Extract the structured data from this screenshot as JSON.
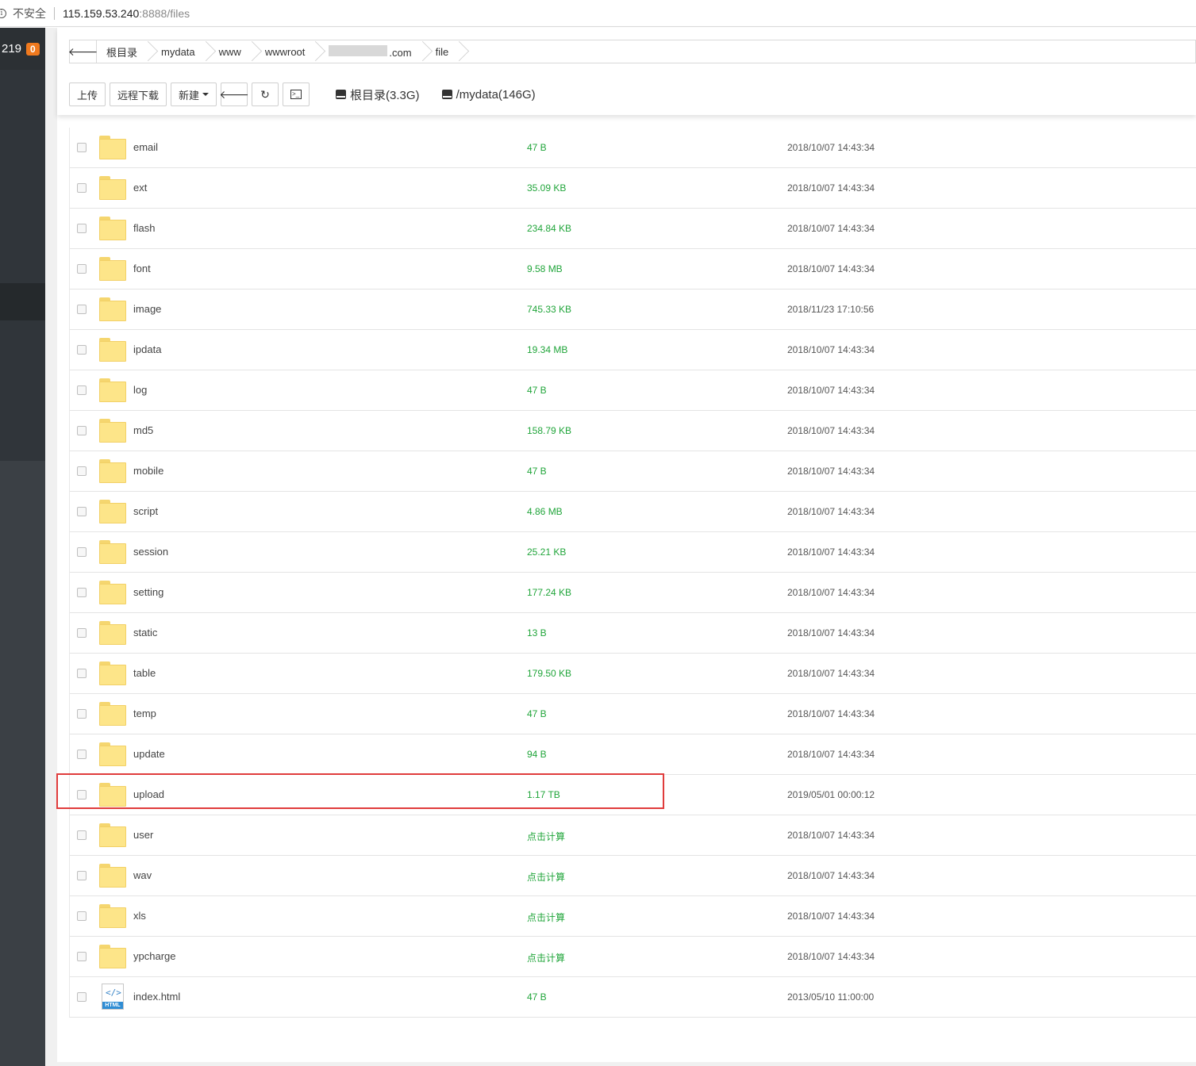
{
  "browser": {
    "insecure_label": "不安全",
    "url_host": "115.159.53.240",
    "url_path": ":8888/files"
  },
  "sidebar": {
    "ip_fragment": "219",
    "badge": "0"
  },
  "breadcrumb": {
    "items": [
      "根目录",
      "mydata",
      "www",
      "wwwroot",
      ".com",
      "file"
    ]
  },
  "toolbar": {
    "upload": "上传",
    "remote_download": "远程下载",
    "new": "新建",
    "disk_root": "根目录(3.3G)",
    "disk_mydata": "/mydata(146G)"
  },
  "files": [
    {
      "name": "email",
      "size": "47 B",
      "time": "2018/10/07 14:43:34",
      "type": "folder"
    },
    {
      "name": "ext",
      "size": "35.09 KB",
      "time": "2018/10/07 14:43:34",
      "type": "folder"
    },
    {
      "name": "flash",
      "size": "234.84 KB",
      "time": "2018/10/07 14:43:34",
      "type": "folder"
    },
    {
      "name": "font",
      "size": "9.58 MB",
      "time": "2018/10/07 14:43:34",
      "type": "folder"
    },
    {
      "name": "image",
      "size": "745.33 KB",
      "time": "2018/11/23 17:10:56",
      "type": "folder"
    },
    {
      "name": "ipdata",
      "size": "19.34 MB",
      "time": "2018/10/07 14:43:34",
      "type": "folder"
    },
    {
      "name": "log",
      "size": "47 B",
      "time": "2018/10/07 14:43:34",
      "type": "folder"
    },
    {
      "name": "md5",
      "size": "158.79 KB",
      "time": "2018/10/07 14:43:34",
      "type": "folder"
    },
    {
      "name": "mobile",
      "size": "47 B",
      "time": "2018/10/07 14:43:34",
      "type": "folder"
    },
    {
      "name": "script",
      "size": "4.86 MB",
      "time": "2018/10/07 14:43:34",
      "type": "folder"
    },
    {
      "name": "session",
      "size": "25.21 KB",
      "time": "2018/10/07 14:43:34",
      "type": "folder"
    },
    {
      "name": "setting",
      "size": "177.24 KB",
      "time": "2018/10/07 14:43:34",
      "type": "folder"
    },
    {
      "name": "static",
      "size": "13 B",
      "time": "2018/10/07 14:43:34",
      "type": "folder"
    },
    {
      "name": "table",
      "size": "179.50 KB",
      "time": "2018/10/07 14:43:34",
      "type": "folder"
    },
    {
      "name": "temp",
      "size": "47 B",
      "time": "2018/10/07 14:43:34",
      "type": "folder"
    },
    {
      "name": "update",
      "size": "94 B",
      "time": "2018/10/07 14:43:34",
      "type": "folder"
    },
    {
      "name": "upload",
      "size": "1.17 TB",
      "time": "2019/05/01 00:00:12",
      "type": "folder"
    },
    {
      "name": "user",
      "size": "点击计算",
      "time": "2018/10/07 14:43:34",
      "type": "folder"
    },
    {
      "name": "wav",
      "size": "点击计算",
      "time": "2018/10/07 14:43:34",
      "type": "folder"
    },
    {
      "name": "xls",
      "size": "点击计算",
      "time": "2018/10/07 14:43:34",
      "type": "folder"
    },
    {
      "name": "ypcharge",
      "size": "点击计算",
      "time": "2018/10/07 14:43:34",
      "type": "folder"
    },
    {
      "name": "index.html",
      "size": "47 B",
      "time": "2013/05/10 11:00:00",
      "type": "html"
    }
  ],
  "icons": {
    "folder_color": "#fde589",
    "size_color": "#20a53a",
    "highlight_color": "#e03c3c"
  }
}
